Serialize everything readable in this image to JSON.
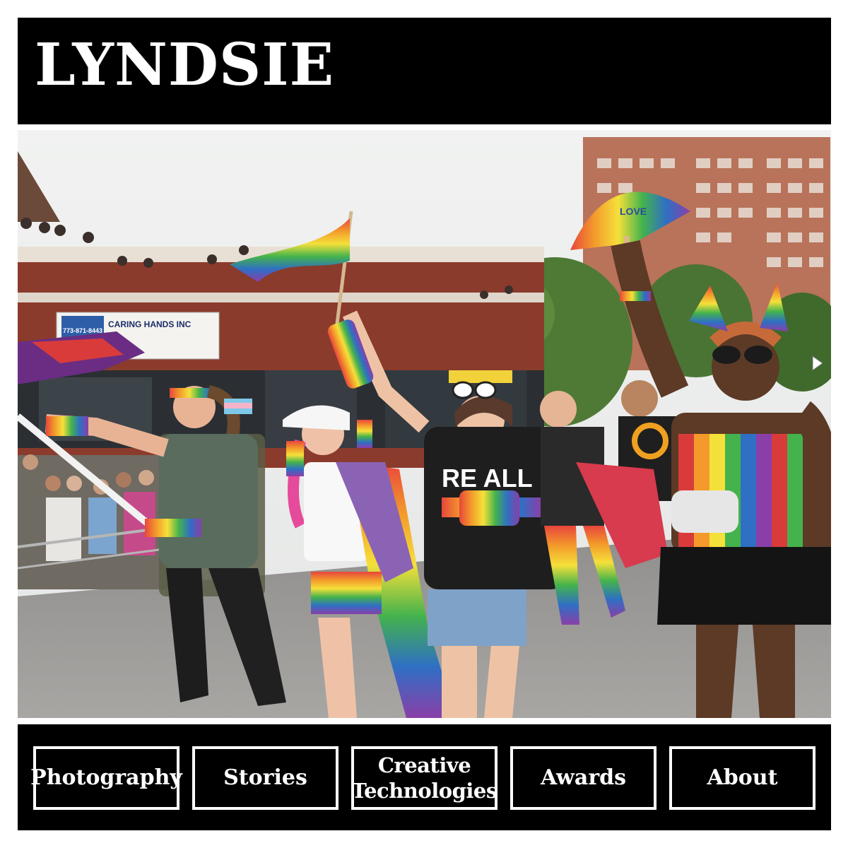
{
  "header": {
    "title": "LYNDSIE"
  },
  "hero": {
    "description_hidden": "",
    "signage": {
      "shop_name": "CARING HANDS INC",
      "phone": "773-871-8443"
    },
    "fan_text": "LOVE",
    "shirt_text": "WE ARE ALL HUMAN",
    "shirt_text_short": "RE ALL"
  },
  "nav": {
    "items": [
      {
        "line1": "Photography",
        "line2": ""
      },
      {
        "line1": "Stories",
        "line2": ""
      },
      {
        "line1": "Creative",
        "line2": "Technologies"
      },
      {
        "line1": "Awards",
        "line2": ""
      },
      {
        "line1": "About",
        "line2": ""
      }
    ]
  },
  "colors": {
    "header_bg": "#000000",
    "nav_bg": "#000000",
    "text": "#ffffff",
    "page_bg": "#ffffff"
  },
  "icons": {
    "slide_next": "play-arrow-icon"
  }
}
